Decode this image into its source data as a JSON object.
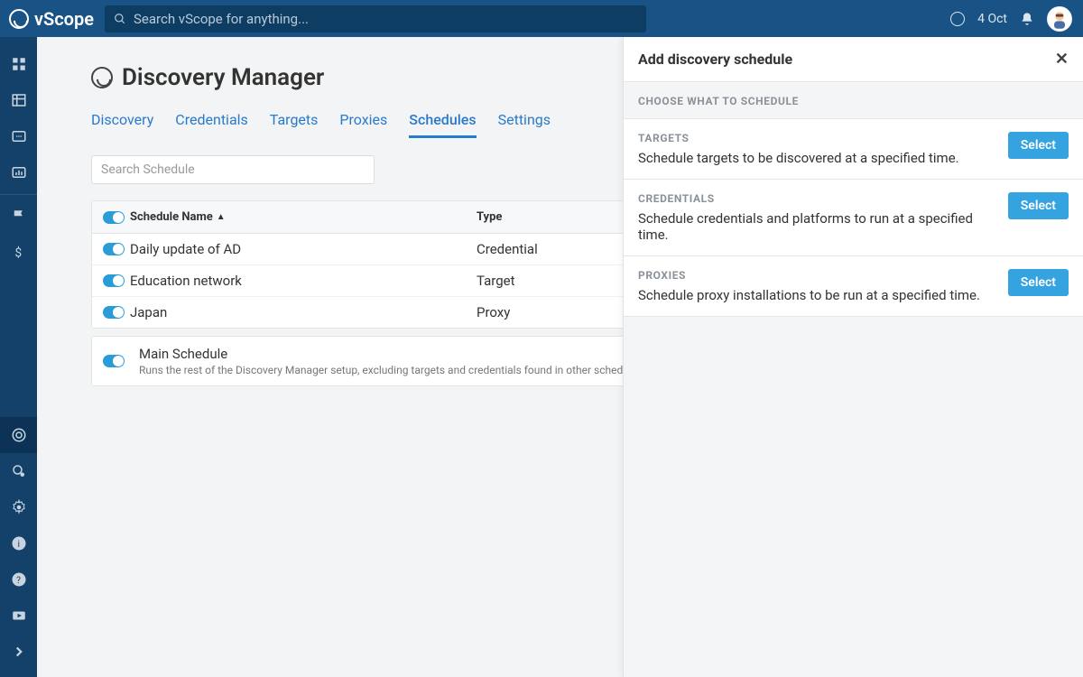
{
  "brand": "vScope",
  "search": {
    "placeholder": "Search vScope for anything..."
  },
  "header": {
    "date": "4 Oct"
  },
  "page": {
    "title": "Discovery Manager"
  },
  "tabs": [
    "Discovery",
    "Credentials",
    "Targets",
    "Proxies",
    "Schedules",
    "Settings"
  ],
  "active_tab": "Schedules",
  "schedule_search": {
    "placeholder": "Search Schedule"
  },
  "table": {
    "columns": {
      "name": "Schedule Name",
      "type": "Type"
    },
    "rows": [
      {
        "name": "Daily update of AD",
        "type": "Credential",
        "enabled": true
      },
      {
        "name": "Education network",
        "type": "Target",
        "enabled": true
      },
      {
        "name": "Japan",
        "type": "Proxy",
        "enabled": true
      }
    ]
  },
  "main_schedule": {
    "title": "Main Schedule",
    "desc": "Runs the rest of the Discovery Manager setup, excluding targets and credentials found in other schedules.",
    "enabled": true
  },
  "panel": {
    "title": "Add discovery schedule",
    "section_label": "CHOOSE WHAT TO SCHEDULE",
    "options": [
      {
        "label": "TARGETS",
        "desc": "Schedule targets to be discovered at a specified time.",
        "button": "Select"
      },
      {
        "label": "CREDENTIALS",
        "desc": "Schedule credentials and platforms to run at a specified time.",
        "button": "Select"
      },
      {
        "label": "PROXIES",
        "desc": "Schedule proxy installations to be run at a specified time.",
        "button": "Select"
      }
    ]
  }
}
